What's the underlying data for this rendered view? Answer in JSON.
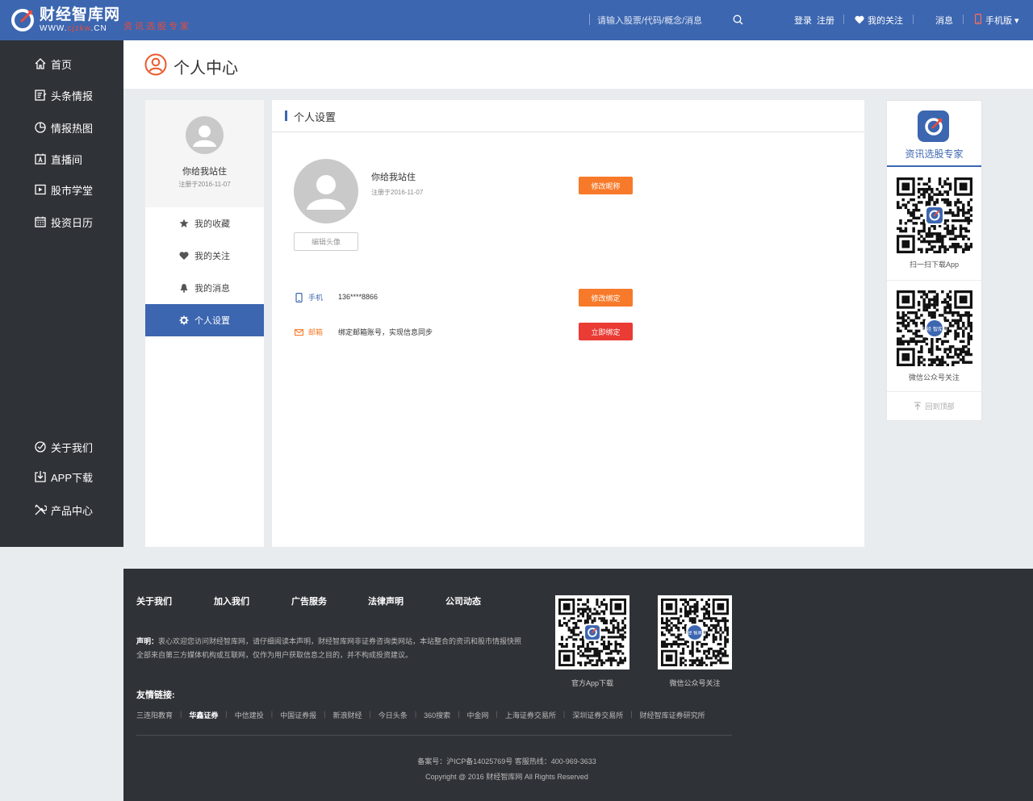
{
  "header": {
    "logo_text": "财经智库网",
    "logo_url_prefix": "WWW.",
    "logo_url_domain": "cjzkw",
    "logo_url_suffix": ".CN",
    "slogan": "资讯选股专家",
    "search_placeholder": "请输入股票/代码/概念/消息",
    "login": "登录",
    "register": "注册",
    "my_follow": "我的关注",
    "messages": "消息",
    "mobile": "手机版 ▾"
  },
  "sidebar": {
    "top_items": [
      {
        "label": "首页",
        "icon": "home-icon"
      },
      {
        "label": "头条情报",
        "icon": "news-icon"
      },
      {
        "label": "情报热图",
        "icon": "pie-chart-icon"
      },
      {
        "label": "直播间",
        "icon": "live-icon"
      },
      {
        "label": "股市学堂",
        "icon": "classroom-icon"
      },
      {
        "label": "投资日历",
        "icon": "calendar-icon"
      }
    ],
    "bottom_items": [
      {
        "label": "关于我们",
        "icon": "about-icon"
      },
      {
        "label": "APP下载",
        "icon": "download-icon"
      },
      {
        "label": "产品中心",
        "icon": "tools-icon"
      }
    ]
  },
  "page": {
    "title": "个人中心"
  },
  "profile": {
    "name": "你给我站住",
    "registered": "注册于2016-11-07",
    "menu": [
      {
        "label": "我的收藏",
        "icon": "star-icon",
        "active": false
      },
      {
        "label": "我的关注",
        "icon": "heart-icon",
        "active": false
      },
      {
        "label": "我的消息",
        "icon": "bell-icon",
        "active": false
      },
      {
        "label": "个人设置",
        "icon": "gear-icon",
        "active": true
      }
    ]
  },
  "settings": {
    "title": "个人设置",
    "name": "你给我站住",
    "registered": "注册于2016-11-07",
    "edit_avatar": "编辑头像",
    "edit_nickname": "修改昵称",
    "phone_label": "手机",
    "phone_value": "136****8866",
    "phone_button": "修改绑定",
    "email_label": "邮箱",
    "email_value": "绑定邮箱账号，实现信息同步",
    "email_button": "立即绑定"
  },
  "right_panel": {
    "app_title": "资讯选股专家",
    "qr1_caption": "扫一扫下载App",
    "qr2_caption": "微信公众号关注",
    "qr2_badge": "财经 智库网",
    "back_to_top": "回到顶部"
  },
  "footer": {
    "links": [
      "关于我们",
      "加入我们",
      "广告服务",
      "法律声明",
      "公司动态"
    ],
    "declaration_label": "声明：",
    "declaration_text": "衷心欢迎您访问财经智库网，请仔细阅读本声明，财经智库网非证券咨询类网站，本站整合的资讯和股市情报快照全部来自第三方媒体机构或互联网，仅作为用户获取信息之目的，并不构成投资建议。",
    "friends_title": "友情链接:",
    "friends": [
      "三连阳教育",
      "华鑫证券",
      "中信建投",
      "中国证券报",
      "新浪财经",
      "今日头条",
      "360搜索",
      "中金网",
      "上海证券交易所",
      "深圳证券交易所",
      "财经智库证券研究所"
    ],
    "icp": "备案号：沪ICP备14025769号    客服热线：400-969-3633",
    "copyright": "Copyright @ 2016 财经智库网 All Rights Reserved",
    "qr1_caption": "官方App下载",
    "qr2_caption": "微信公众号关注"
  },
  "colors": {
    "brand_blue": "#3c66b0",
    "sidebar_dark": "#2f3237",
    "orange": "#f77a2a",
    "red": "#ea3b34"
  }
}
